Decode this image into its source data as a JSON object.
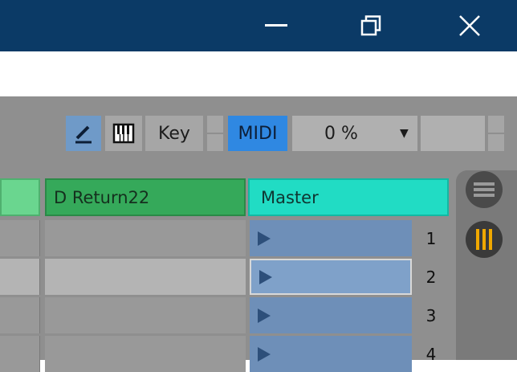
{
  "window": {
    "minimize_icon": "minimize-icon",
    "restore_icon": "restore-icon",
    "close_icon": "close-icon"
  },
  "controls": {
    "draw_icon": "pencil-icon",
    "keys_icon": "piano-keys-icon",
    "key_label": "Key",
    "midi_label": "MIDI",
    "percent_value": "0 %",
    "dropdown_icon": "triangle-down-icon"
  },
  "tracks": {
    "return_label": "D Return22",
    "master_label": "Master"
  },
  "scenes": [
    "1",
    "2",
    "3",
    "4"
  ],
  "side": {
    "top_icon": "menu-lines-icon",
    "bottom_icon": "mixer-bars-icon"
  },
  "colors": {
    "titlebar": "#0b3a66",
    "midi": "#2f88e2",
    "return": "#35a95a",
    "master": "#21dcc4",
    "clip": "#6e8fb8",
    "accent_orange": "#f0a800"
  }
}
